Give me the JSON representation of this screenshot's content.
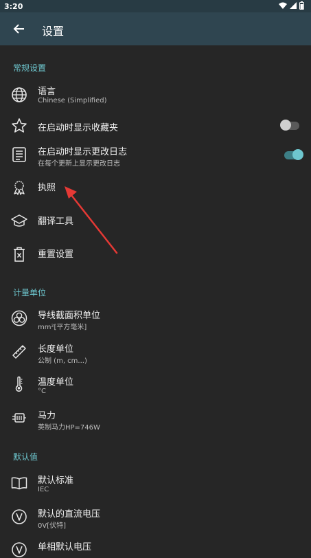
{
  "status_bar": {
    "time": "3:20"
  },
  "app_bar": {
    "title": "设置"
  },
  "sections": {
    "general": {
      "header": "常规设置",
      "language": {
        "label": "语言",
        "value": "Chinese (Simplified)"
      },
      "show_favorites": {
        "label": "在启动时显示收藏夹",
        "enabled": false
      },
      "show_changelog": {
        "label": "在启动时显示更改日志",
        "sub": "在每个更新上显示更改日志",
        "enabled": true
      },
      "license": {
        "label": "执照"
      },
      "translation": {
        "label": "翻译工具"
      },
      "reset": {
        "label": "重置设置"
      }
    },
    "units": {
      "header": "计量单位",
      "cross_section": {
        "label": "导线截面积单位",
        "value": "mm²[平方毫米]"
      },
      "length": {
        "label": "长度单位",
        "value": "公制 (m, cm...)"
      },
      "temperature": {
        "label": "温度单位",
        "value": "°C"
      },
      "power": {
        "label": "马力",
        "value": "英制马力HP=746W"
      }
    },
    "defaults": {
      "header": "默认值",
      "standard": {
        "label": "默认标准",
        "value": "IEC"
      },
      "dc_voltage": {
        "label": "默认的直流电压",
        "value": "0V[伏特]"
      },
      "single_phase": {
        "label": "单相默认电压",
        "value": ""
      }
    }
  },
  "colors": {
    "accent": "#6ec7cf",
    "app_bar": "#2f4550",
    "background": "#262626",
    "annotation_arrow": "#e53935"
  }
}
